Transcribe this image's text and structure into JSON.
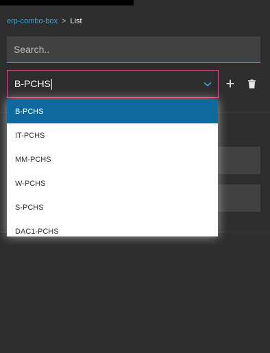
{
  "breadcrumb": {
    "link": "erp-combo-box",
    "separator": ">",
    "current": "List"
  },
  "search": {
    "placeholder": "Search..",
    "value": ""
  },
  "combo": {
    "value": "B-PCHS",
    "border_color": "#d44f8e"
  },
  "actions": {
    "add_icon": "plus-icon",
    "delete_icon": "trash-icon"
  },
  "dropdown": {
    "selected_index": 0,
    "options": [
      "B-PCHS",
      "IT-PCHS",
      "MM-PCHS",
      "W-PCHS",
      "S-PCHS",
      "DAC1-PCHS"
    ]
  },
  "colors": {
    "accent": "#35a7e0",
    "selected_bg": "#0e6a9e",
    "background": "#2d2d2d"
  }
}
